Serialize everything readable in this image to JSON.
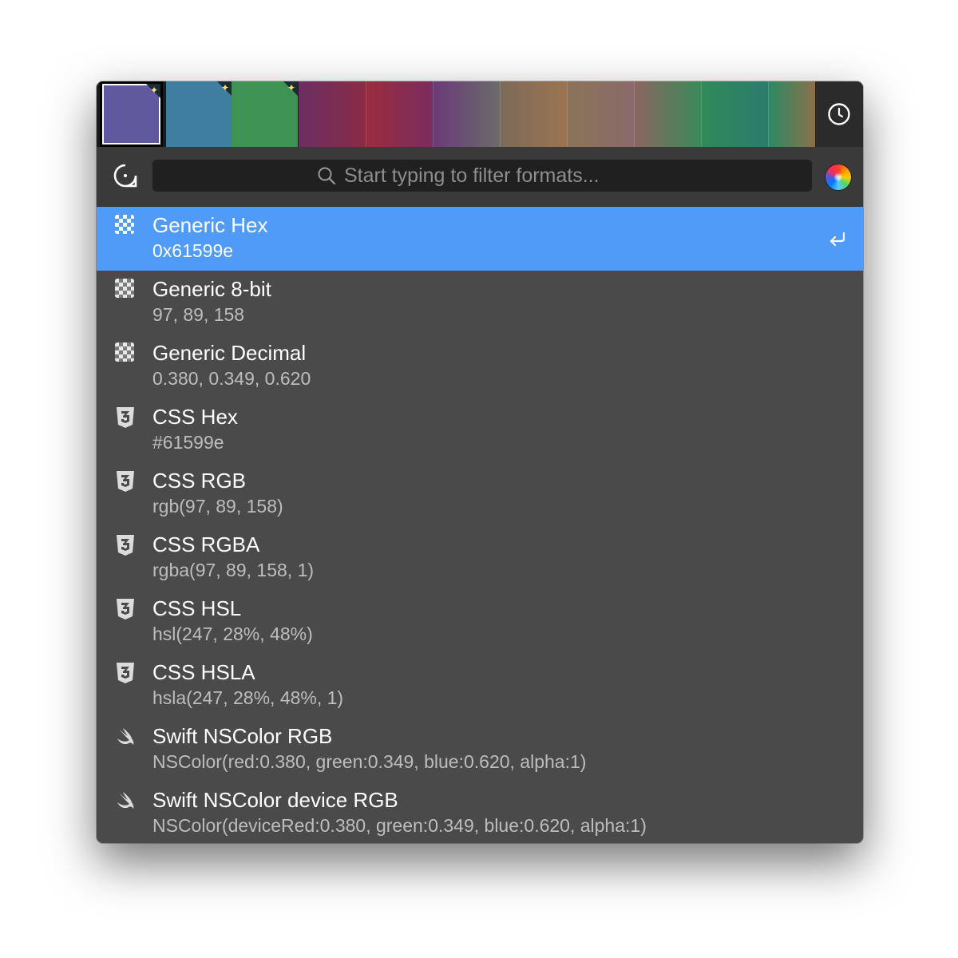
{
  "swatches": [
    {
      "color": "#61599e",
      "selected": true
    },
    {
      "color": "#3f7e9f"
    },
    {
      "color": "#3e9253"
    }
  ],
  "gradients": [
    [
      "#6b2f62",
      "#8a2b45"
    ],
    [
      "#9a2c3f",
      "#7a2d5e"
    ],
    [
      "#6a3a78",
      "#6b6b6b"
    ],
    [
      "#7b6a5a",
      "#9c7450"
    ],
    [
      "#8a7458",
      "#8a6a6a"
    ],
    [
      "#8a6660",
      "#3a8a5a"
    ],
    [
      "#2f8a58",
      "#2c7c6e"
    ],
    [
      "#2c8a66",
      "#8a7048"
    ]
  ],
  "search": {
    "placeholder": "Start typing to filter formats..."
  },
  "formats": [
    {
      "name": "Generic Hex",
      "value": "0x61599e",
      "icon": "checker-icon",
      "selected": true
    },
    {
      "name": "Generic 8-bit",
      "value": "97, 89, 158",
      "icon": "checker-icon"
    },
    {
      "name": "Generic Decimal",
      "value": "0.380, 0.349, 0.620",
      "icon": "checker-icon"
    },
    {
      "name": "CSS Hex",
      "value": "#61599e",
      "icon": "css3-icon"
    },
    {
      "name": "CSS RGB",
      "value": "rgb(97, 89, 158)",
      "icon": "css3-icon"
    },
    {
      "name": "CSS RGBA",
      "value": "rgba(97, 89, 158, 1)",
      "icon": "css3-icon"
    },
    {
      "name": "CSS HSL",
      "value": "hsl(247, 28%, 48%)",
      "icon": "css3-icon"
    },
    {
      "name": "CSS HSLA",
      "value": "hsla(247, 28%, 48%, 1)",
      "icon": "css3-icon"
    },
    {
      "name": "Swift NSColor RGB",
      "value": "NSColor(red:0.380, green:0.349, blue:0.620, alpha:1)",
      "icon": "swift-icon"
    },
    {
      "name": "Swift NSColor device RGB",
      "value": "NSColor(deviceRed:0.380, green:0.349, blue:0.620, alpha:1)",
      "icon": "swift-icon"
    }
  ],
  "colors": {
    "selection": "#4f9bf7",
    "panel": "#4a4a4a"
  }
}
